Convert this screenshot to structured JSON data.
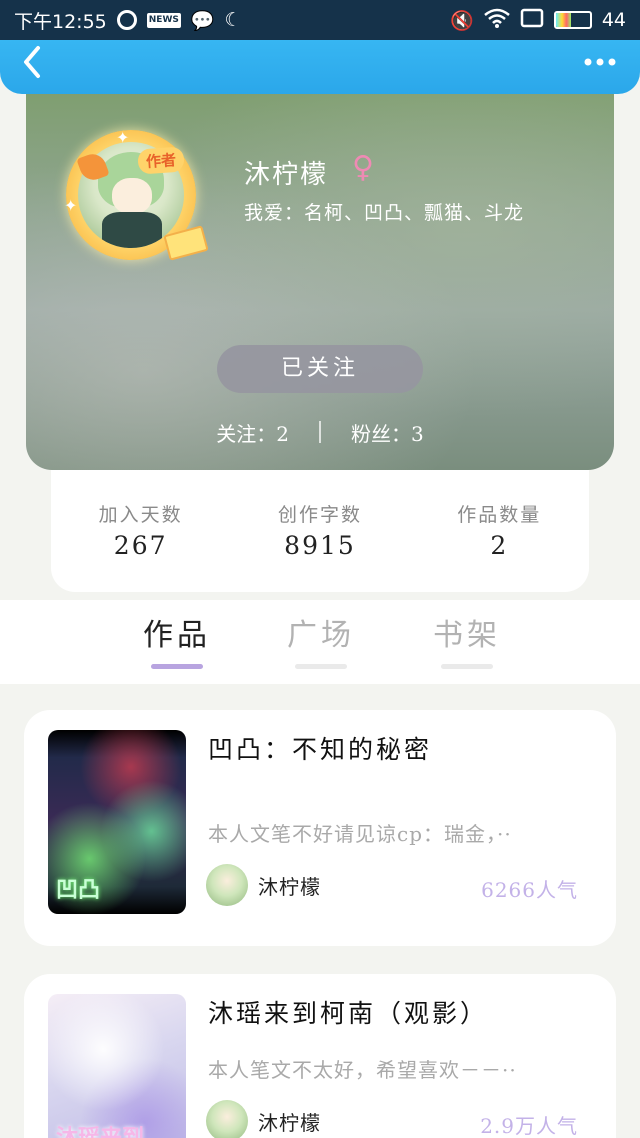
{
  "status_bar": {
    "time": "下午12:55",
    "news_badge": "NEWS",
    "battery_level": "44",
    "battery_fill": 0.44
  },
  "nav": {
    "back_icon": "‹",
    "more_icon": "•••"
  },
  "profile": {
    "author_tag": "作者",
    "username": "沐柠檬",
    "gender_icon": "♀",
    "likes": "我爱：名柯、凹凸、瓢猫、斗龙",
    "follow_button": "已关注",
    "following_label": "关注：2",
    "followers_label": "粉丝：3"
  },
  "stats": [
    {
      "label": "加入天数",
      "value": "267"
    },
    {
      "label": "创作字数",
      "value": "8915"
    },
    {
      "label": "作品数量",
      "value": "2"
    }
  ],
  "tabs": [
    {
      "label": "作品",
      "active": true
    },
    {
      "label": "广场",
      "active": false
    },
    {
      "label": "书架",
      "active": false
    }
  ],
  "works": [
    {
      "title": "凹凸：不知的秘密",
      "description": "本人文笔不好请见谅cp：瑞金，··",
      "author": "沐柠檬",
      "popularity": "6266人气",
      "cover_text": "凹凸"
    },
    {
      "title": "沐瑶来到柯南（观影）",
      "description": "本人笔文不太好，希望喜欢－－··",
      "author": "沐柠檬",
      "popularity": "2.9万人气",
      "cover_text": "沐瑶来到"
    }
  ]
}
